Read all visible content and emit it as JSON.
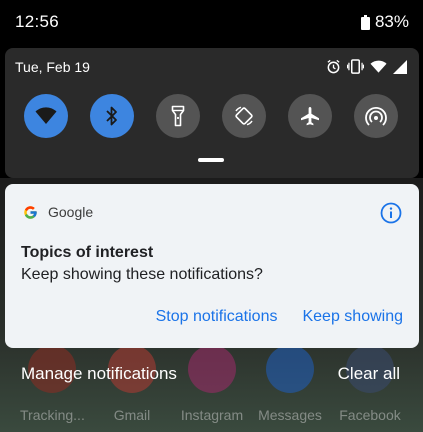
{
  "status_bar": {
    "time": "12:56",
    "battery_percent": "83%"
  },
  "quick_settings": {
    "date": "Tue, Feb 19",
    "status_icons": [
      "alarm-icon",
      "vibrate-icon",
      "wifi-signal-icon",
      "cell-signal-icon"
    ],
    "tiles": [
      {
        "name": "wifi",
        "icon": "wifi-icon",
        "active": true
      },
      {
        "name": "bluetooth",
        "icon": "bluetooth-icon",
        "active": true
      },
      {
        "name": "flashlight",
        "icon": "flashlight-icon",
        "active": false
      },
      {
        "name": "auto-rotate",
        "icon": "auto-rotate-icon",
        "active": false
      },
      {
        "name": "airplane-mode",
        "icon": "airplane-icon",
        "active": false
      },
      {
        "name": "hotspot",
        "icon": "hotspot-icon",
        "active": false
      }
    ]
  },
  "notification": {
    "app_name": "Google",
    "title": "Topics of interest",
    "body": "Keep showing these notifications?",
    "actions": {
      "stop": "Stop notifications",
      "keep": "Keep showing"
    }
  },
  "footer": {
    "manage": "Manage notifications",
    "clear_all": "Clear all"
  },
  "dock": {
    "apps": [
      {
        "label": "Tracking...",
        "color": "#c0392b"
      },
      {
        "label": "Gmail",
        "color": "#d9534f"
      },
      {
        "label": "Instagram",
        "color": "#c13584"
      },
      {
        "label": "Messages",
        "color": "#1a73e8"
      },
      {
        "label": "Facebook",
        "color": "#3b5998"
      }
    ]
  },
  "colors": {
    "accent_blue": "#1a73e8",
    "tile_on": "#3d85e0",
    "tile_off": "#545454",
    "panel_bg": "#2a2a2a",
    "card_bg": "#f0f3f6"
  }
}
